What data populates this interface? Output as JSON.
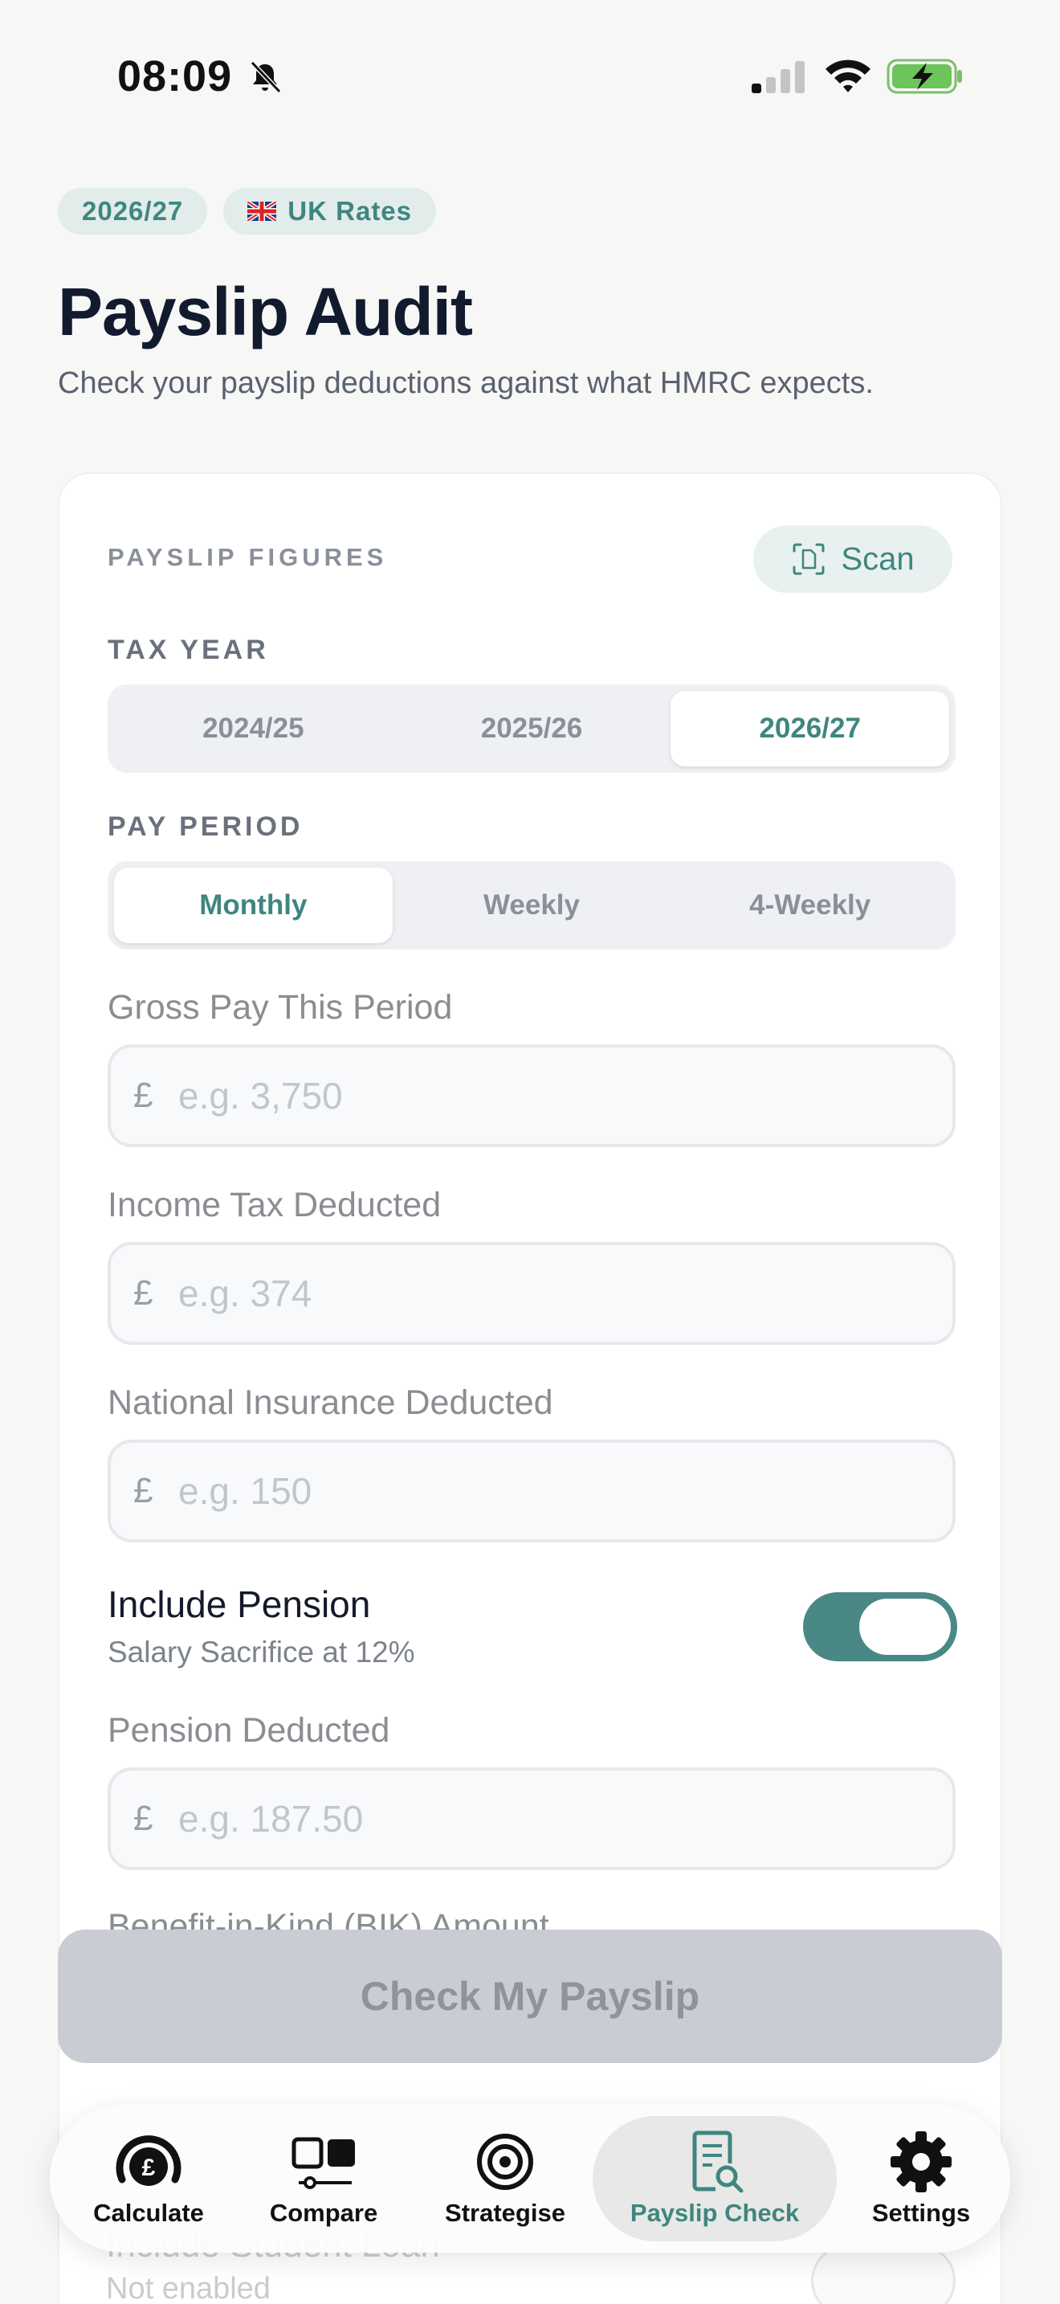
{
  "status_bar": {
    "time": "08:09"
  },
  "chips": {
    "year": "2026/27",
    "rates": "UK Rates"
  },
  "header": {
    "title": "Payslip Audit",
    "subtitle": "Check your payslip deductions against what HMRC expects."
  },
  "card": {
    "section_label": "PAYSLIP FIGURES",
    "scan_label": "Scan",
    "tax_year": {
      "label": "TAX YEAR",
      "options": [
        "2024/25",
        "2025/26",
        "2026/27"
      ],
      "selected": "2026/27"
    },
    "pay_period": {
      "label": "PAY PERIOD",
      "options": [
        "Monthly",
        "Weekly",
        "4-Weekly"
      ],
      "selected": "Monthly"
    },
    "currency_symbol": "£",
    "gross_pay": {
      "label": "Gross Pay This Period",
      "placeholder": "e.g. 3,750",
      "value": ""
    },
    "income_tax": {
      "label": "Income Tax Deducted",
      "placeholder": "e.g. 374",
      "value": ""
    },
    "national_insurance": {
      "label": "National Insurance Deducted",
      "placeholder": "e.g. 150",
      "value": ""
    },
    "pension_toggle": {
      "title": "Include Pension",
      "subtitle": "Salary Sacrifice at 12%",
      "enabled": true
    },
    "pension_deducted": {
      "label": "Pension Deducted",
      "placeholder": "e.g. 187.50",
      "value": ""
    },
    "bik_label": "Benefit-in-Kind (BIK) Amount",
    "student_loan": {
      "title": "Include Student Loan",
      "subtitle": "Not enabled"
    }
  },
  "check_button": "Check My Payslip",
  "tabbar": {
    "items": [
      {
        "label": "Calculate",
        "icon": "gauge-pound-icon"
      },
      {
        "label": "Compare",
        "icon": "compare-icon"
      },
      {
        "label": "Strategise",
        "icon": "target-icon"
      },
      {
        "label": "Payslip Check",
        "icon": "payslip-search-icon"
      },
      {
        "label": "Settings",
        "icon": "gear-icon"
      }
    ],
    "active": "Payslip Check"
  },
  "colors": {
    "accent": "#3f8680",
    "toggle_on": "#4a8885",
    "background": "#f7f7f6",
    "button_disabled": "#c9ccd3"
  }
}
